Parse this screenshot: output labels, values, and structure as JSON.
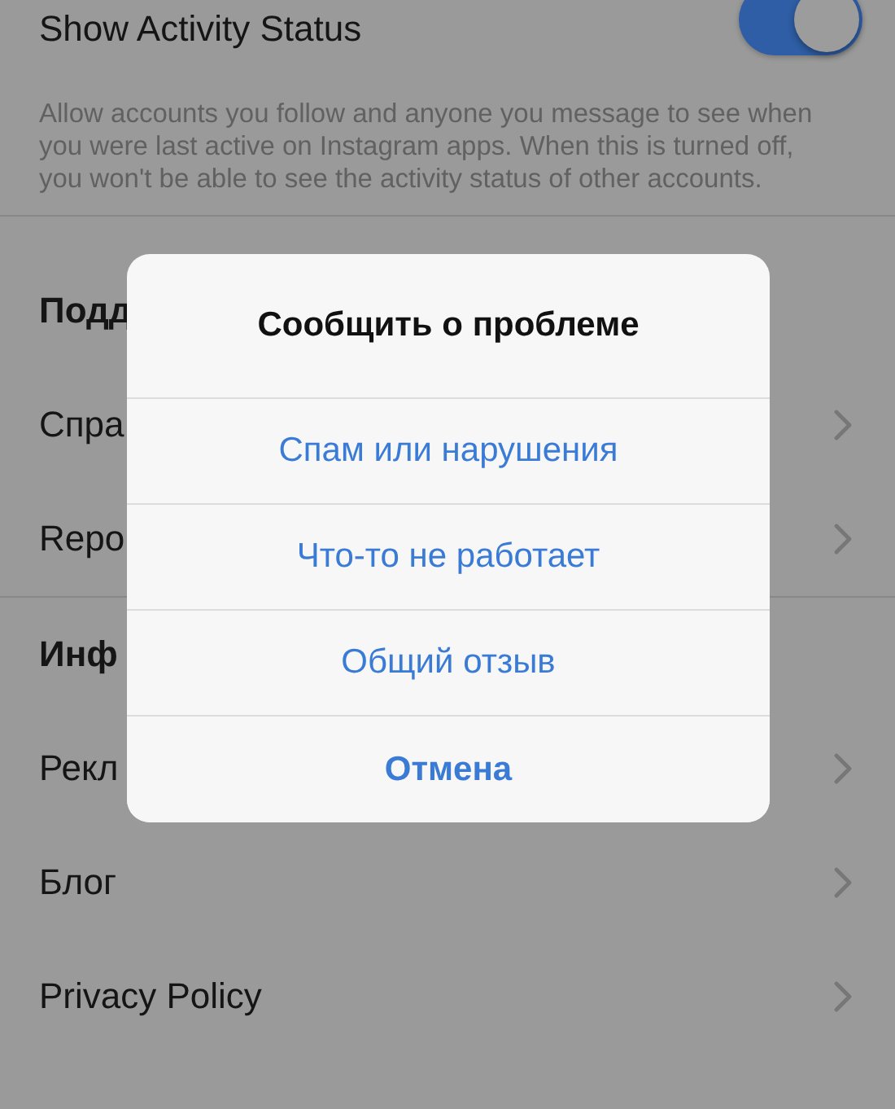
{
  "settings": [
    {
      "kind": "toggle",
      "label": "Show Activity Status",
      "on": true
    },
    {
      "kind": "description",
      "text": "Allow accounts you follow and anyone you message to see when you were last active on Instagram apps. When this is turned off, you won't be able to see the activity status of other accounts."
    },
    {
      "kind": "header",
      "label": "Подд"
    },
    {
      "kind": "link",
      "label": "Спра"
    },
    {
      "kind": "link",
      "label": "Repo"
    },
    {
      "kind": "divider"
    },
    {
      "kind": "header",
      "label": "Инф"
    },
    {
      "kind": "link",
      "label": "Рекл"
    },
    {
      "kind": "link",
      "label": "Блог"
    },
    {
      "kind": "link",
      "label": "Privacy Policy"
    }
  ],
  "dialog": {
    "title": "Сообщить о проблеме",
    "options": [
      {
        "kind": "option",
        "label": "Спам или нарушения"
      },
      {
        "kind": "option",
        "label": "Что-то не работает"
      },
      {
        "kind": "option",
        "label": "Общий отзыв"
      },
      {
        "kind": "cancel",
        "label": "Отмена"
      }
    ]
  }
}
